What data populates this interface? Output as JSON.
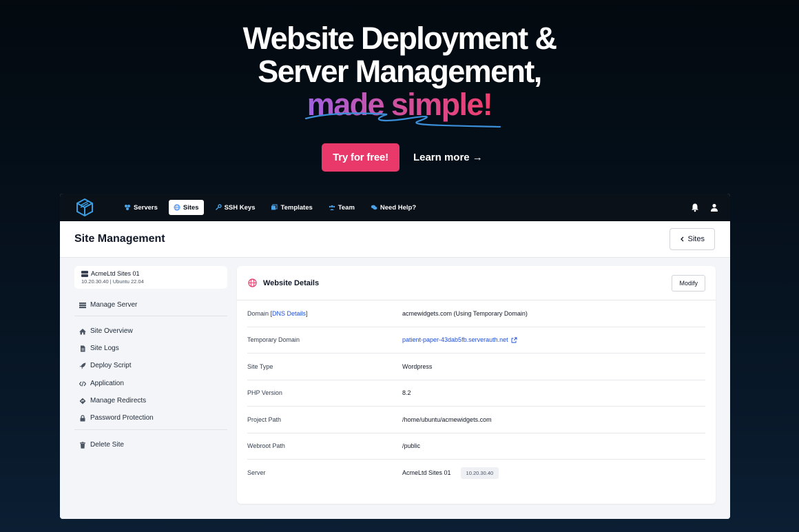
{
  "hero": {
    "line1": "Website Deployment &",
    "line2": "Server Management,",
    "highlight": "made simple!",
    "try_label": "Try for free!",
    "learn_label": "Learn more →"
  },
  "colors": {
    "accent": "#e9386a",
    "nav_bg": "#0b1119",
    "link": "#1d4ed8"
  },
  "nav": {
    "items": [
      {
        "label": "Servers",
        "icon": "servers-icon"
      },
      {
        "label": "Sites",
        "icon": "globe-icon",
        "active": true
      },
      {
        "label": "SSH Keys",
        "icon": "key-icon"
      },
      {
        "label": "Templates",
        "icon": "templates-icon"
      },
      {
        "label": "Team",
        "icon": "team-icon"
      },
      {
        "label": "Need Help?",
        "icon": "chat-icon"
      }
    ]
  },
  "header": {
    "title": "Site Management",
    "back_label": "Sites"
  },
  "server": {
    "name": "AcmeLtd Sites 01",
    "meta": "10.20.30.40 | Ubuntu 22.04"
  },
  "sidebar": {
    "manage_server": "Manage Server",
    "site_overview": "Site Overview",
    "site_logs": "Site Logs",
    "deploy_script": "Deploy Script",
    "application": "Application",
    "manage_redirects": "Manage Redirects",
    "password_protection": "Password Protection",
    "delete_site": "Delete Site"
  },
  "panel": {
    "title": "Website Details",
    "modify_label": "Modify",
    "rows": [
      {
        "label": "Domain",
        "link": "DNS Details",
        "value": "acmewidgets.com (Using Temporary Domain)"
      },
      {
        "label": "Temporary Domain",
        "value": "patient-paper-43dab5fb.serverauth.net"
      },
      {
        "label": "Site Type",
        "value": "Wordpress"
      },
      {
        "label": "PHP Version",
        "value": "8.2"
      },
      {
        "label": "Project Path",
        "value": "/home/ubuntu/acmewidgets.com"
      },
      {
        "label": "Webroot Path",
        "value": "/public"
      },
      {
        "label": "Server",
        "value": "AcmeLtd Sites 01",
        "badge": "10.20.30.40"
      }
    ]
  }
}
